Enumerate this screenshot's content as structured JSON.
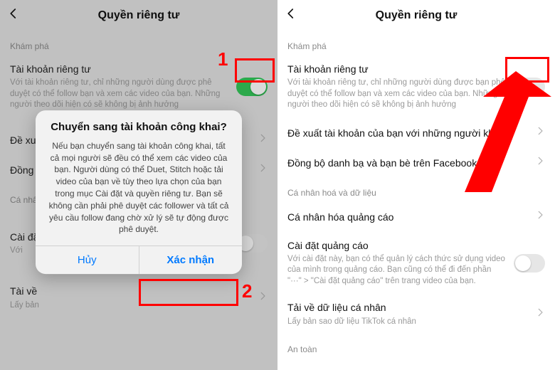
{
  "header": {
    "title": "Quyền riêng tư"
  },
  "left": {
    "section_explore": "Khám phá",
    "private_account": {
      "title": "Tài khoản riêng tư",
      "desc": "Với tài khoản riêng tư, chỉ những người dùng được phê duyệt có thể follow bạn và xem các video của bạn. Những người theo dõi hiện có sẽ không bị ảnh hưởng"
    },
    "suggest": {
      "title": "Đề xuất tài khoản của bạn với những người khác"
    },
    "sync": {
      "title": "Đồng bộ"
    },
    "section_personal": "Cá nhân",
    "ad_settings": {
      "title": "Cài đặt",
      "desc": "Với"
    },
    "download": {
      "title": "Tài về",
      "desc": "Lấy bản"
    }
  },
  "right": {
    "section_explore": "Khám phá",
    "private_account": {
      "title": "Tài khoản riêng tư",
      "desc": "Với tài khoản riêng tư, chỉ những người dùng được bạn phê duyệt có thể follow bạn và xem các video của bạn. Những người theo dõi hiện có sẽ không bị ảnh hưởng"
    },
    "suggest": {
      "title": "Đề xuất tài khoản của bạn với những người khác"
    },
    "sync": {
      "title": "Đồng bộ danh bạ và bạn bè trên Facebook"
    },
    "section_personal": "Cá nhân hoá và dữ liệu",
    "ad_personalize": {
      "title": "Cá nhân hóa quảng cáo"
    },
    "ad_settings": {
      "title": "Cài đặt quảng cáo",
      "desc": "Với cài đặt này, bạn có thể quản lý cách thức sử dụng video của mình trong quảng cáo. Bạn cũng có thể đi đến phần \"···\" > \"Cài đặt quảng cáo\" trên trang video của bạn."
    },
    "download": {
      "title": "Tải về dữ liệu cá nhân",
      "desc": "Lấy bản sao dữ liệu TikTok cá nhân"
    },
    "section_safety": "An toàn"
  },
  "modal": {
    "title": "Chuyển sang tài khoản công khai?",
    "body": "Nếu bạn chuyển sang tài khoản công khai, tất cả mọi người sẽ đều có thể xem các video của bạn. Người dùng có thể Duet, Stitch hoặc tải video của bạn về tùy theo lựa chọn của bạn trong mục Cài đặt và quyền riêng tư. Bạn sẽ không cần phải phê duyệt các follower và tất cả yêu cầu follow đang chờ xử lý sẽ tự động được phê duyệt.",
    "cancel": "Hủy",
    "confirm": "Xác nhận"
  },
  "annot": {
    "one": "1",
    "two": "2"
  }
}
